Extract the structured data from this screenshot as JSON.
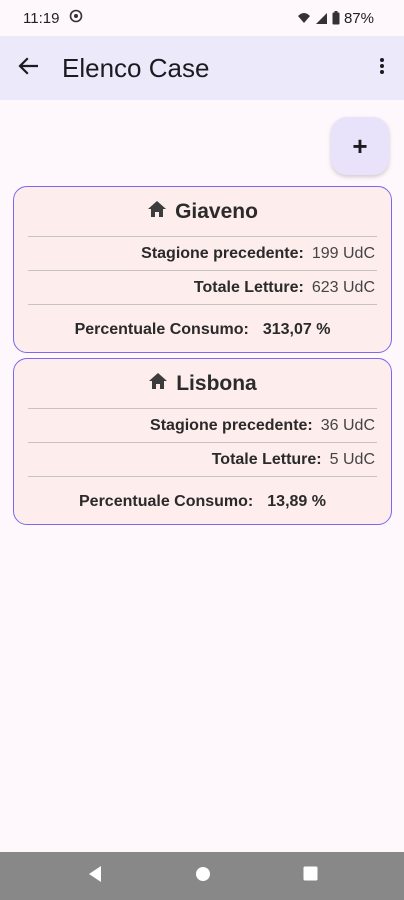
{
  "status_bar": {
    "time": "11:19",
    "battery": "87%"
  },
  "app_bar": {
    "title": "Elenco Case"
  },
  "fab": {
    "label": "+"
  },
  "houses": [
    {
      "name": "Giaveno",
      "previous_season_label": "Stagione precedente:",
      "previous_season_value": "199 UdC",
      "total_readings_label": "Totale Letture:",
      "total_readings_value": "623 UdC",
      "consumption_label": "Percentuale Consumo:",
      "consumption_value": "313,07 %"
    },
    {
      "name": "Lisbona",
      "previous_season_label": "Stagione precedente:",
      "previous_season_value": "36 UdC",
      "total_readings_label": "Totale Letture:",
      "total_readings_value": "5 UdC",
      "consumption_label": "Percentuale Consumo:",
      "consumption_value": "13,89 %"
    }
  ],
  "icons": {
    "back": "arrow-back-icon",
    "menu": "more-vert-icon",
    "house": "home-icon",
    "nav_back": "nav-back-icon",
    "nav_home": "nav-home-icon",
    "nav_recents": "nav-recents-icon"
  },
  "colors": {
    "app_bar": "#ece9fb",
    "card_bg": "#fdedec",
    "card_border": "#7b68ee",
    "fab_bg": "#e9e2fb",
    "nav_bar": "#888888"
  }
}
